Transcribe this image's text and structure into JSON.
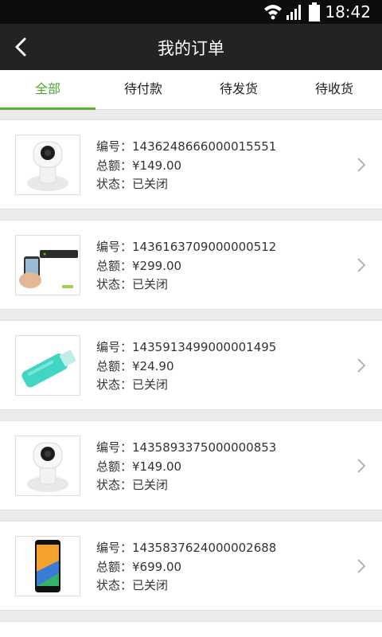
{
  "status_bar": {
    "time": "18:42"
  },
  "header": {
    "title": "我的订单",
    "back_icon": "back-arrow-icon"
  },
  "tabs": [
    {
      "label": "全部",
      "active": true
    },
    {
      "label": "待付款",
      "active": false
    },
    {
      "label": "待发货",
      "active": false
    },
    {
      "label": "待收货",
      "active": false
    }
  ],
  "labels": {
    "order_no": "编号：",
    "total": "总额：",
    "status": "状态："
  },
  "orders": [
    {
      "order_no": "1436248666000015551",
      "total": "¥149.00",
      "status": "已关闭",
      "thumb": "camera"
    },
    {
      "order_no": "1436163709000000512",
      "total": "¥299.00",
      "status": "已关闭",
      "thumb": "tv-box"
    },
    {
      "order_no": "1435913499000001495",
      "total": "¥24.90",
      "status": "已关闭",
      "thumb": "usb-drive"
    },
    {
      "order_no": "1435893375000000853",
      "total": "¥149.00",
      "status": "已关闭",
      "thumb": "camera"
    },
    {
      "order_no": "1435837624000002688",
      "total": "¥699.00",
      "status": "已关闭",
      "thumb": "phone"
    }
  ],
  "colors": {
    "accent": "#5bb32f",
    "header_bg": "#232323",
    "statusbar_bg": "#0d0d0d"
  }
}
